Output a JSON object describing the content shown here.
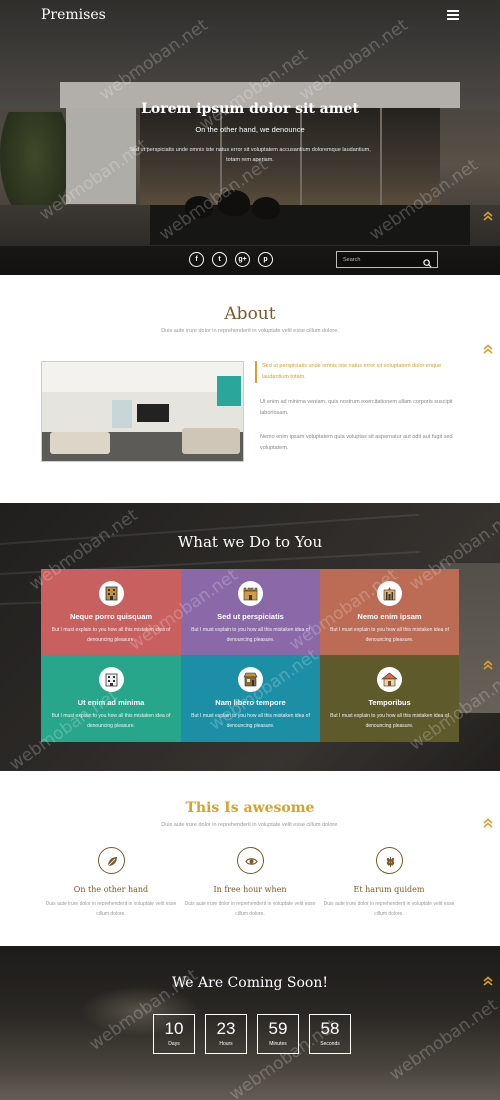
{
  "header": {
    "brand": "Premises",
    "menu_icon": "hamburger-menu-icon"
  },
  "hero": {
    "title": "Lorem ipsum dolor sit amet",
    "subtitle": "On the other hand, we denounce",
    "body": "Sed ut perspiciatis unde omnis iste natus error sit voluptatem accusantium doloremque laudantium, totam rem aperiam.",
    "socials": [
      {
        "icon": "facebook-icon",
        "glyph": "f"
      },
      {
        "icon": "twitter-icon",
        "glyph": "t"
      },
      {
        "icon": "google-plus-icon",
        "glyph": "g+"
      },
      {
        "icon": "pinterest-icon",
        "glyph": "p"
      }
    ],
    "search_placeholder": "Search"
  },
  "watermark": "webmoban.net",
  "about": {
    "title": "About",
    "subtitle": "Duis aute irure dolor in reprehenderit in voluptate velit esse cillum dolore.",
    "quote": "Sed ut perspiciatis unde omnis iste natus error sit voluptatem dolor enque laudantium totam.",
    "p1": "Ut enim ad minima veniam, quis nostrum exercitationem ullam corporis suscipit laboriosam.",
    "p2": "Nemo enim ipsam voluptatem quia voluptas sit aspernatur aut odit aut fugit sed voluptatem."
  },
  "services": {
    "title": "What we Do to You",
    "tiles": [
      {
        "title": "Neque porro quisquam",
        "desc": "But I must explain to you how all this mistaken idea of denouncing pleasure.",
        "color": "#c8605f",
        "icon": "building-icon"
      },
      {
        "title": "Sed ut perspiciatis",
        "desc": "But I must explain to you how all this mistaken idea of denouncing pleasure.",
        "color": "#8b68a8",
        "icon": "castle-icon"
      },
      {
        "title": "Nemo enim ipsam",
        "desc": "But I must explain to you how all this mistaken idea of denouncing pleasure.",
        "color": "#bc6c55",
        "icon": "palace-icon"
      },
      {
        "title": "Ut enim ad minima",
        "desc": "But I must explain to you how all this mistaken idea of denouncing pleasure.",
        "color": "#27a68b",
        "icon": "office-icon"
      },
      {
        "title": "Nam libero tempore",
        "desc": "But I must explain to you how all this mistaken idea of denouncing pleasure.",
        "color": "#1c8fa6",
        "icon": "shop-icon"
      },
      {
        "title": "Temporibus",
        "desc": "But I must explain to you how all this mistaken idea of denouncing pleasure.",
        "color": "#5f5a2c",
        "icon": "house-icon"
      }
    ]
  },
  "awesome": {
    "title": "This Is awesome",
    "subtitle": "Duis aute irure dolor in reprehenderit in voluptate velit esse cillum dolore.",
    "features": [
      {
        "title": "On the other hand",
        "desc": "Duis aute irure dolor in reprehenderit in voluptate velit esse cillum dolore.",
        "icon": "leaf-icon"
      },
      {
        "title": "In free hour when",
        "desc": "Duis aute irure dolor in reprehenderit in voluptate velit esse cillum dolore.",
        "icon": "eye-icon"
      },
      {
        "title": "Et harum quidem",
        "desc": "Duis aute irure dolor in reprehenderit in voluptate velit esse cillum dolore.",
        "icon": "wheat-icon"
      }
    ]
  },
  "coming": {
    "title": "We Are Coming Soon!",
    "counters": [
      {
        "value": "10",
        "unit": "Days"
      },
      {
        "value": "23",
        "unit": "Hours"
      },
      {
        "value": "59",
        "unit": "Minutes"
      },
      {
        "value": "58",
        "unit": "Seconds"
      }
    ]
  },
  "colors": {
    "accent": "#d8a12b",
    "brown": "#7a5a2a"
  }
}
